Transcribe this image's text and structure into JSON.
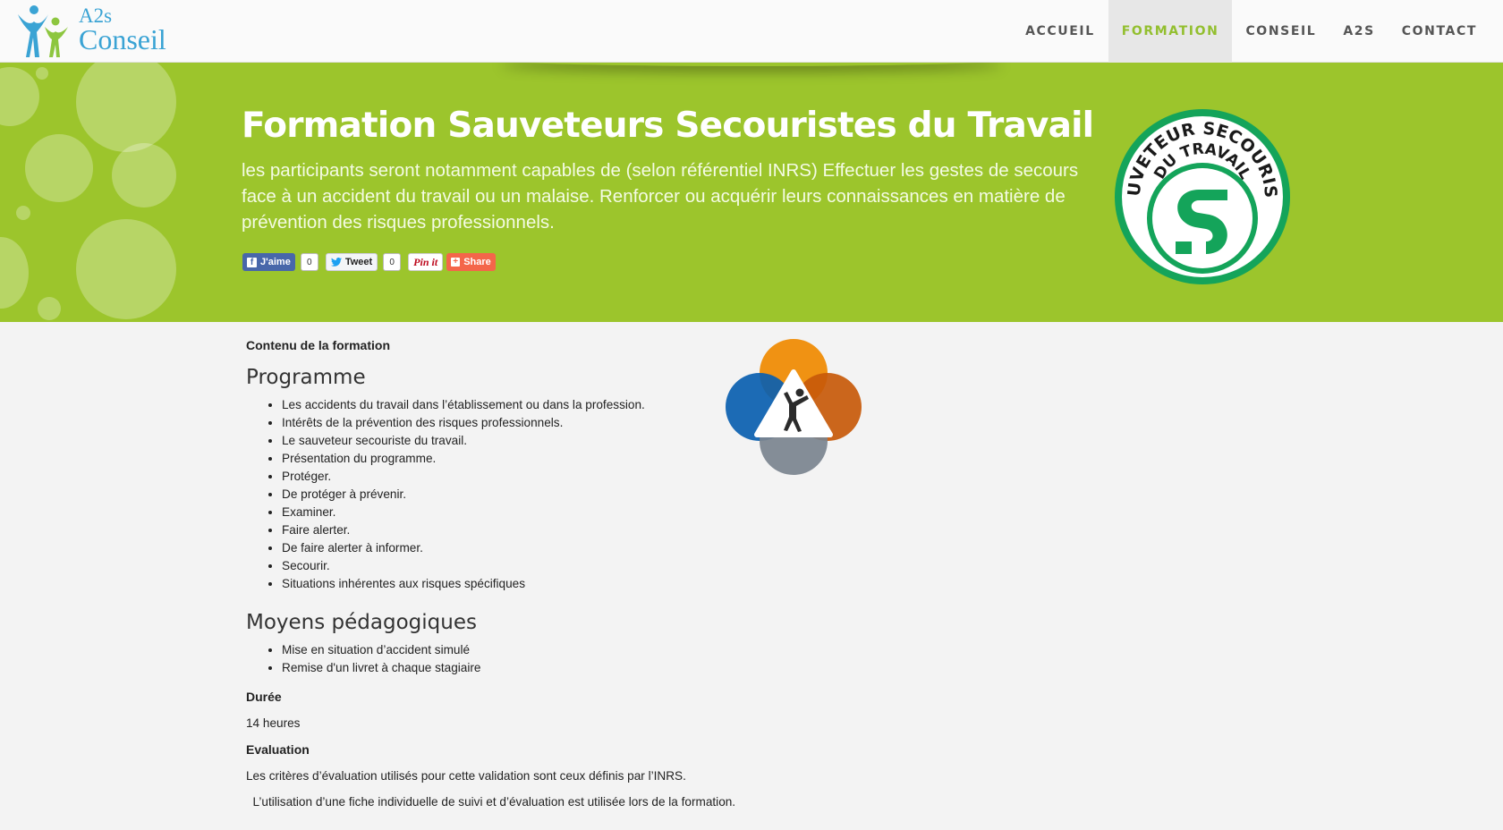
{
  "brand": {
    "line1": "A2s",
    "line2": "Conseil"
  },
  "nav": {
    "items": [
      {
        "label": "ACCUEIL",
        "active": false
      },
      {
        "label": "FORMATION",
        "active": true
      },
      {
        "label": "CONSEIL",
        "active": false
      },
      {
        "label": "A2S",
        "active": false
      },
      {
        "label": "CONTACT",
        "active": false
      }
    ]
  },
  "hero": {
    "title": "Formation Sauveteurs Secouristes du Travail",
    "lead": "les participants seront notamment capables de (selon référentiel INRS) Effectuer les gestes de secours face à un accident du travail ou un malaise. Renforcer ou acquérir leurs connaissances en matière de prévention des risques professionnels.",
    "share": {
      "facebook_label": "J'aime",
      "facebook_count": "0",
      "twitter_label": "Tweet",
      "twitter_count": "0",
      "pinterest_label": "Pin it",
      "share_label": "Share"
    },
    "badge": {
      "top_text": "SAUVETEUR SECOURISTE",
      "bottom_text": "DU TRAVAIL"
    }
  },
  "content": {
    "section_label": "Contenu de la formation",
    "programme_title": "Programme",
    "programme_items": [
      "Les accidents du travail dans l’établissement ou dans la profession.",
      "Intérêts de la prévention des risques professionnels.",
      "Le  sauveteur secouriste du travail.",
      "Présentation du programme.",
      "Protéger.",
      "De protéger à prévenir.",
      "Examiner.",
      "Faire alerter.",
      "De faire alerter à informer.",
      "Secourir.",
      "Situations inhérentes aux risques spécifiques"
    ],
    "moyens_title": "Moyens pédagogiques",
    "moyens_items": [
      "Mise en situation d’accident simulé",
      "Remise d'un livret à chaque stagiaire"
    ],
    "duree_label": "Durée",
    "duree_value": "14 heures",
    "evaluation_label": "Evaluation",
    "evaluation_text_1": "Les critères d’évaluation utilisés pour cette validation sont ceux définis par  l’INRS.",
    "evaluation_text_2": "  L’utilisation d’une fiche individuelle de suivi et d’évaluation est utilisée lors de la formation."
  },
  "colors": {
    "accent_green": "#9cc52c",
    "nav_active": "#93bf2f",
    "logo_blue": "#3aa3d4",
    "badge_green": "#14a45a"
  }
}
